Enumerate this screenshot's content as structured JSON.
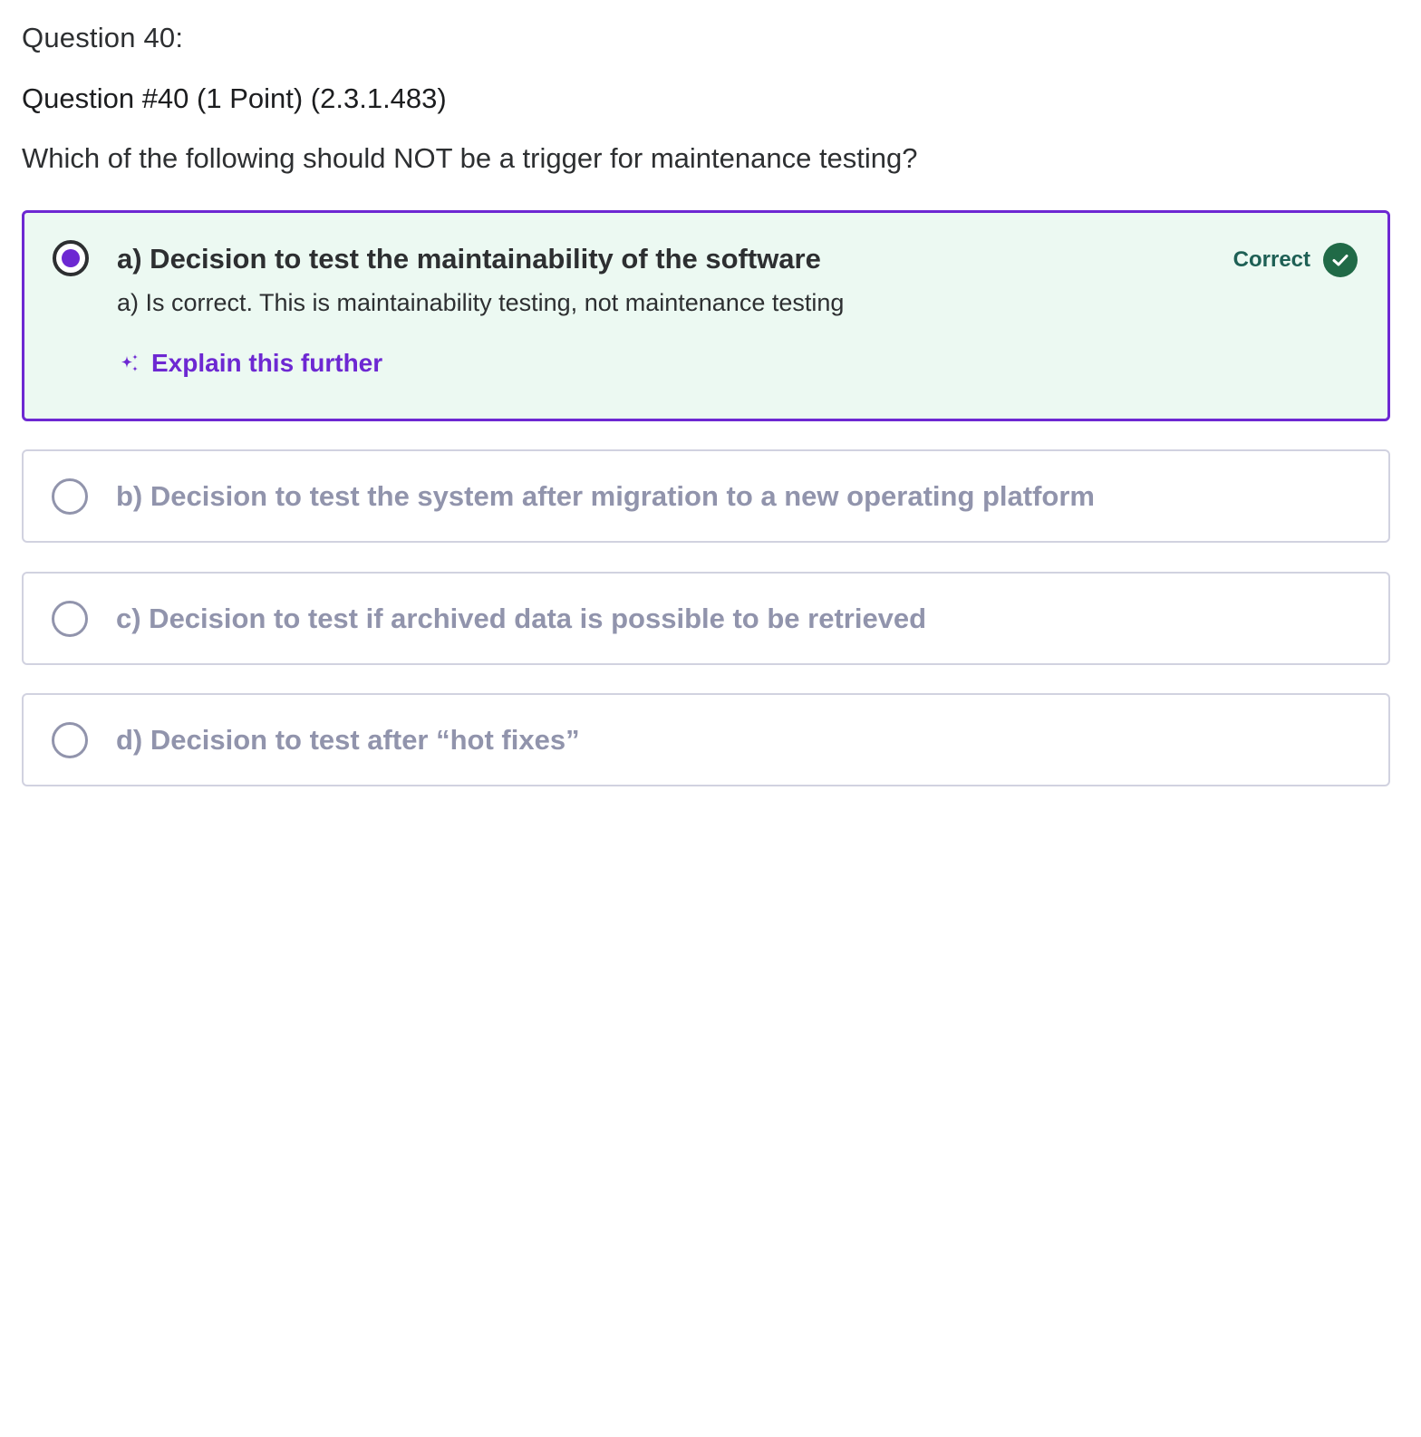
{
  "question": {
    "header": "Question 40:",
    "meta": "Question #40 (1 Point) (2.3.1.483)",
    "prompt": "Which of the following should NOT be a trigger for maintenance testing?"
  },
  "options": [
    {
      "label": "a) Decision to test the maintainability of the software",
      "selected": true,
      "status": "Correct",
      "explanation": "a) Is correct. This is maintainability testing, not maintenance testing",
      "action_label": "Explain this further"
    },
    {
      "label": "b) Decision to test the system after migration to a new operating platform",
      "selected": false
    },
    {
      "label": "c) Decision to test if archived data is possible to be retrieved",
      "selected": false
    },
    {
      "label": "d) Decision to test after “hot fixes”",
      "selected": false
    }
  ],
  "icons": {
    "selected_radio": "radio-checked-icon",
    "unselected_radio": "radio-unchecked-icon",
    "status": "check-circle-icon",
    "action": "sparkle-icon"
  },
  "colors": {
    "accent": "#6d28d2",
    "correct_bg": "#ecf9f2",
    "correct_text": "#1e6055",
    "correct_icon": "#206a47",
    "muted_text": "#9194ac",
    "border": "#d1d2e0"
  }
}
